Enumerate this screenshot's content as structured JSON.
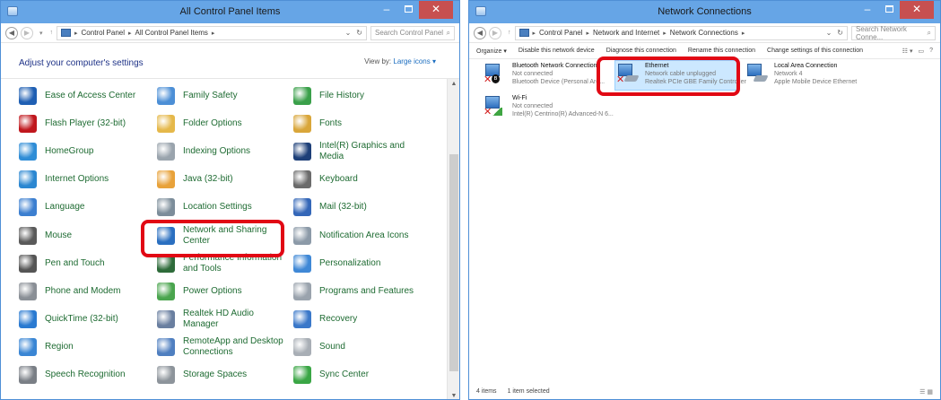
{
  "control_panel": {
    "window_title": "All Control Panel Items",
    "address": [
      "Control Panel",
      "All Control Panel Items"
    ],
    "search_placeholder": "Search Control Panel",
    "heading": "Adjust your computer's settings",
    "view_by_label": "View by:",
    "view_by_value": "Large icons",
    "items": [
      {
        "label": "Ease of Access Center",
        "icon": "ease-of-access-icon",
        "color": "#1f5fb3"
      },
      {
        "label": "Family Safety",
        "icon": "family-safety-icon",
        "color": "#4c8fd6"
      },
      {
        "label": "File History",
        "icon": "file-history-icon",
        "color": "#3aa04a"
      },
      {
        "label": "Flash Player (32-bit)",
        "icon": "flash-player-icon",
        "color": "#c0171d"
      },
      {
        "label": "Folder Options",
        "icon": "folder-options-icon",
        "color": "#e5b84a"
      },
      {
        "label": "Fonts",
        "icon": "fonts-icon",
        "color": "#d9a63a"
      },
      {
        "label": "HomeGroup",
        "icon": "homegroup-icon",
        "color": "#2f8dd6"
      },
      {
        "label": "Indexing Options",
        "icon": "indexing-options-icon",
        "color": "#9aa4ad"
      },
      {
        "label": "Intel(R) Graphics and Media",
        "icon": "intel-graphics-icon",
        "color": "#1d3f78"
      },
      {
        "label": "Internet Options",
        "icon": "internet-options-icon",
        "color": "#2b87d1"
      },
      {
        "label": "Java (32-bit)",
        "icon": "java-icon",
        "color": "#e8a23a"
      },
      {
        "label": "Keyboard",
        "icon": "keyboard-icon",
        "color": "#6b6b6b"
      },
      {
        "label": "Language",
        "icon": "language-icon",
        "color": "#3c7fd0"
      },
      {
        "label": "Location Settings",
        "icon": "location-settings-icon",
        "color": "#7c8d9a"
      },
      {
        "label": "Mail (32-bit)",
        "icon": "mail-icon",
        "color": "#3467b8"
      },
      {
        "label": "Mouse",
        "icon": "mouse-icon",
        "color": "#5a5a5a"
      },
      {
        "label": "Network and Sharing Center",
        "icon": "network-sharing-icon",
        "color": "#2a6fc0"
      },
      {
        "label": "Notification Area Icons",
        "icon": "notification-area-icon",
        "color": "#8c9aa8"
      },
      {
        "label": "Pen and Touch",
        "icon": "pen-touch-icon",
        "color": "#555555"
      },
      {
        "label": "Performance Information and Tools",
        "icon": "performance-icon",
        "color": "#2e6b3a"
      },
      {
        "label": "Personalization",
        "icon": "personalization-icon",
        "color": "#3f88d6"
      },
      {
        "label": "Phone and Modem",
        "icon": "phone-modem-icon",
        "color": "#8a8f96"
      },
      {
        "label": "Power Options",
        "icon": "power-options-icon",
        "color": "#4aa54e"
      },
      {
        "label": "Programs and Features",
        "icon": "programs-features-icon",
        "color": "#9aa3ad"
      },
      {
        "label": "QuickTime (32-bit)",
        "icon": "quicktime-icon",
        "color": "#2a7ad1"
      },
      {
        "label": "Realtek HD Audio Manager",
        "icon": "realtek-audio-icon",
        "color": "#6a7fa0"
      },
      {
        "label": "Recovery",
        "icon": "recovery-icon",
        "color": "#3a78c9"
      },
      {
        "label": "Region",
        "icon": "region-icon",
        "color": "#3a86d4"
      },
      {
        "label": "RemoteApp and Desktop Connections",
        "icon": "remoteapp-icon",
        "color": "#4f7fc0"
      },
      {
        "label": "Sound",
        "icon": "sound-icon",
        "color": "#a8aeb5"
      },
      {
        "label": "Speech Recognition",
        "icon": "speech-recognition-icon",
        "color": "#7a7f86"
      },
      {
        "label": "Storage Spaces",
        "icon": "storage-spaces-icon",
        "color": "#8d949b"
      },
      {
        "label": "Sync Center",
        "icon": "sync-center-icon",
        "color": "#3aa645"
      }
    ]
  },
  "network_connections": {
    "window_title": "Network Connections",
    "address": [
      "Control Panel",
      "Network and Internet",
      "Network Connections"
    ],
    "search_placeholder": "Search Network Conne...",
    "toolbar": [
      "Organize ▾",
      "Disable this network device",
      "Diagnose this connection",
      "Rename this connection",
      "Change settings of this connection"
    ],
    "connections": [
      {
        "name": "Bluetooth Network Connection",
        "status": "Not connected",
        "device": "Bluetooth Device (Personal Are...",
        "badge": "bluetooth"
      },
      {
        "name": "Ethernet",
        "status": "Network cable unplugged",
        "device": "Realtek PCIe GBE Family Controller",
        "badge": "cable"
      },
      {
        "name": "Local Area Connection",
        "status": "Network 4",
        "device": "Apple Mobile Device Ethernet",
        "badge": "cable"
      },
      {
        "name": "Wi-Fi",
        "status": "Not connected",
        "device": "Intel(R) Centrino(R) Advanced-N 6...",
        "badge": "wifi"
      }
    ],
    "status_items": "4 items",
    "status_selected": "1 item selected"
  },
  "colors": {
    "highlight": "#e10814",
    "selection": "#cce8ff",
    "link_green": "#1e6b32",
    "titlebar": "#66a5e6"
  }
}
